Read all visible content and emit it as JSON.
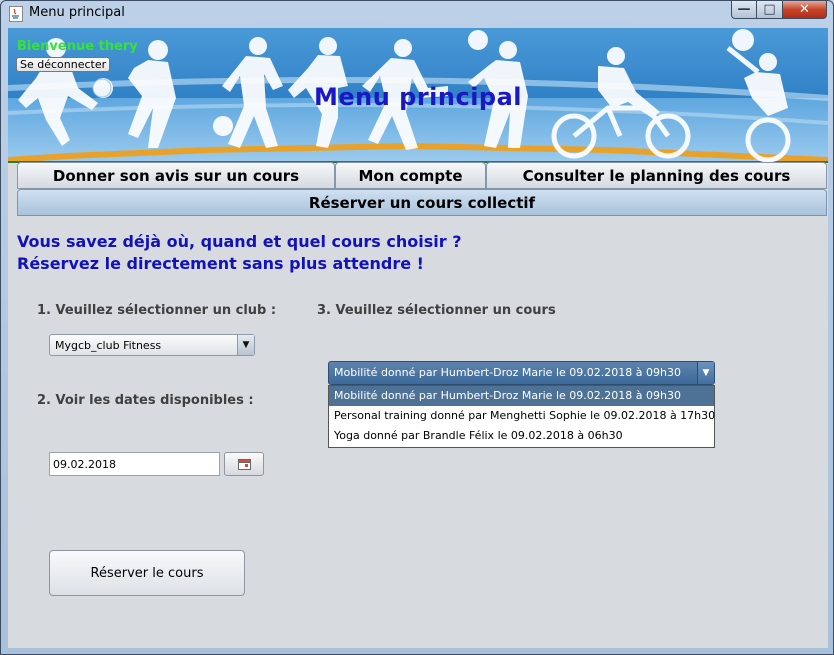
{
  "window": {
    "title": "Menu principal",
    "controls": {
      "minimize": "—",
      "maximize": "□",
      "close": "✕"
    }
  },
  "banner": {
    "welcome": "Bienvenue thery",
    "logout_label": "Se déconnecter",
    "title": "Menu principal"
  },
  "tabs": [
    {
      "label": "Donner son avis sur un cours"
    },
    {
      "label": "Mon compte"
    },
    {
      "label": "Consulter le planning des cours"
    },
    {
      "label": "Réserver un cours collectif"
    }
  ],
  "content": {
    "intro_line1": "Vous savez déjà où, quand et quel cours choisir ?",
    "intro_line2": "Réservez le directement sans plus attendre !",
    "step1_label": "1. Veuillez sélectionner un club :",
    "club_selected": "Mygcb_club Fitness",
    "step2_label": "2. Voir les dates disponibles :",
    "date_value": "09.02.2018",
    "step3_label": "3. Veuillez sélectionner un cours",
    "course_selected": "Mobilité donné par Humbert-Droz Marie le 09.02.2018 à 09h30",
    "course_options": [
      "Mobilité donné par Humbert-Droz Marie le 09.02.2018 à 09h30",
      "Personal training donné par Menghetti Sophie le 09.02.2018 à 17h30",
      "Yoga donné par Brandle Félix le 09.02.2018 à 06h30"
    ],
    "reserve_label": "Réserver le cours"
  }
}
